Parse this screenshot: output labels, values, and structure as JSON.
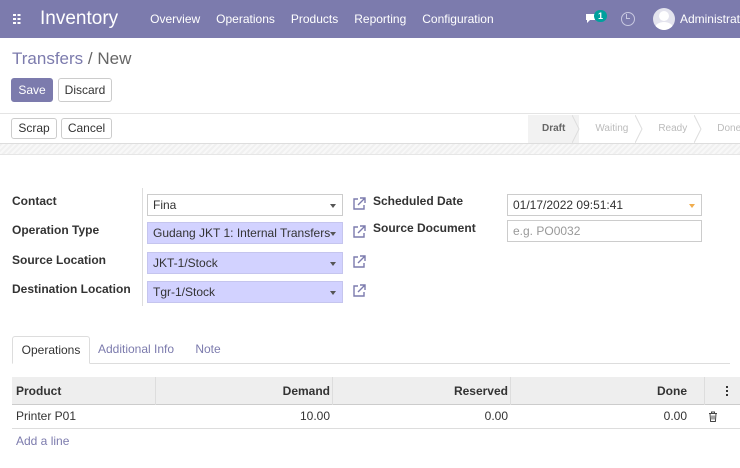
{
  "navbar": {
    "app_name": "Inventory",
    "menu": [
      "Overview",
      "Operations",
      "Products",
      "Reporting",
      "Configuration"
    ],
    "chat_count": "1",
    "user": "Administrat",
    "color": "#7c7bad"
  },
  "breadcrumb": {
    "parent": "Transfers",
    "separator": "/",
    "current": "New"
  },
  "actions": {
    "save": "Save",
    "discard": "Discard"
  },
  "header_buttons": {
    "scrap": "Scrap",
    "cancel": "Cancel"
  },
  "statusbar": {
    "stages": [
      "Draft",
      "Waiting",
      "Ready",
      "Done"
    ],
    "active": "Draft"
  },
  "form": {
    "contact": {
      "label": "Contact",
      "value": "Fina"
    },
    "operation_type": {
      "label": "Operation Type",
      "value": "Gudang JKT 1: Internal Transfers"
    },
    "source_location": {
      "label": "Source Location",
      "value": "JKT-1/Stock"
    },
    "destination_location": {
      "label": "Destination Location",
      "value": "Tgr-1/Stock"
    },
    "scheduled_date": {
      "label": "Scheduled Date",
      "value": "01/17/2022 09:51:41"
    },
    "source_document": {
      "label": "Source Document",
      "placeholder": "e.g. PO0032"
    }
  },
  "tabs": [
    "Operations",
    "Additional Info",
    "Note"
  ],
  "table": {
    "columns": [
      "Product",
      "Demand",
      "Reserved",
      "Done"
    ],
    "rows": [
      {
        "product": "Printer P01",
        "demand": "10.00",
        "reserved": "0.00",
        "done": "0.00"
      }
    ],
    "add_line": "Add a line"
  }
}
